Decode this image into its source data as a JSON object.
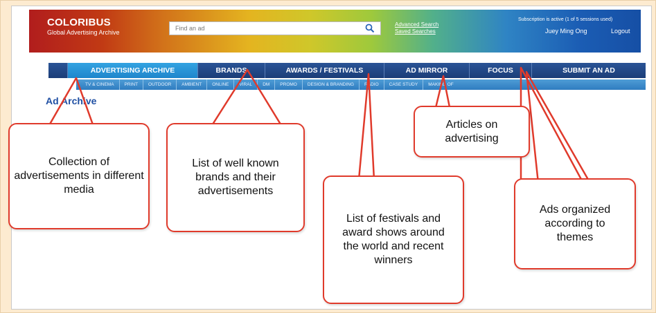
{
  "header": {
    "logo_title": "COLORIBUS",
    "logo_subtitle": "Global Advertising Archive",
    "search_placeholder": "Find an ad",
    "advanced_search": "Advanced Search",
    "saved_searches": "Saved Searches",
    "subscription_status": "Subscription is active (1 of 5 sessions used)",
    "user_name": "Juey Ming Ong",
    "logout": "Logout"
  },
  "nav": {
    "items": [
      {
        "label": "ADVERTISING ARCHIVE",
        "active": true
      },
      {
        "label": "BRANDS"
      },
      {
        "label": "AWARDS / FESTIVALS"
      },
      {
        "label": "AD MIRROR"
      },
      {
        "label": "FOCUS"
      },
      {
        "label": "SUBMIT AN AD"
      }
    ]
  },
  "subnav": {
    "items": [
      "TV & CINEMA",
      "PRINT",
      "OUTDOOR",
      "AMBIENT",
      "ONLINE",
      "VIRAL",
      "DM",
      "PROMO",
      "DESIGN & BRANDING",
      "RADIO",
      "CASE STUDY",
      "MAKING OF"
    ]
  },
  "page": {
    "heading": "Ad Archive"
  },
  "callouts": {
    "archive": "Collection of advertisements in different media",
    "brands": "List of well known brands and their advertisements",
    "festivals": "List of festivals and award shows around the world and recent winners",
    "mirror": "Articles on advertising",
    "focus": "Ads organized according to themes"
  },
  "colors": {
    "callout_border": "#e03a2b",
    "nav_bg": "#1b3e78",
    "nav_active": "#1f86cc",
    "background": "#fdebd0"
  }
}
